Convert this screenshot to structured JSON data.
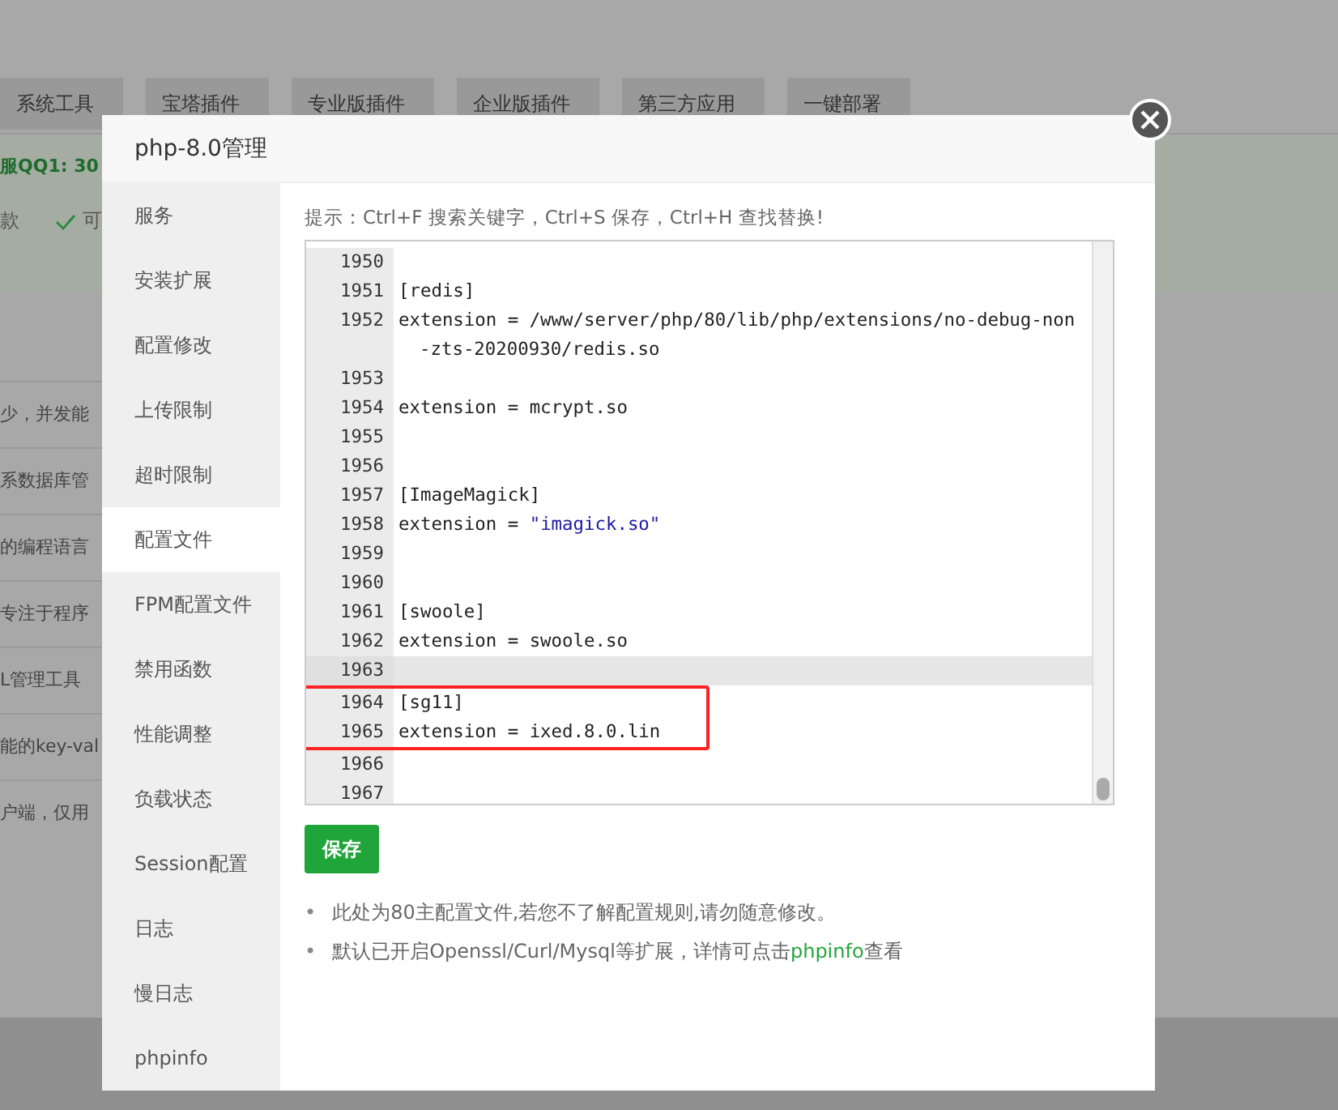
{
  "background": {
    "tabs": [
      {
        "label": "系统工具"
      },
      {
        "label": "宝塔插件"
      },
      {
        "label": "专业版插件"
      },
      {
        "label": "企业版插件"
      },
      {
        "label": "第三方应用"
      },
      {
        "label": "一键部署"
      }
    ],
    "banner": {
      "title": "服QQ1: 30",
      "items": [
        "款",
        "可"
      ]
    },
    "rows": [
      "少，并发能",
      "系数据库管",
      "的编程语言",
      "专注于程序",
      "L管理工具",
      "能的key-val",
      "户端，仅用"
    ]
  },
  "dialog": {
    "title": "php-8.0管理",
    "sidebar": [
      {
        "label": "服务",
        "selected": false
      },
      {
        "label": "安装扩展",
        "selected": false
      },
      {
        "label": "配置修改",
        "selected": false
      },
      {
        "label": "上传限制",
        "selected": false
      },
      {
        "label": "超时限制",
        "selected": false
      },
      {
        "label": "配置文件",
        "selected": true
      },
      {
        "label": "FPM配置文件",
        "selected": false
      },
      {
        "label": "禁用函数",
        "selected": false
      },
      {
        "label": "性能调整",
        "selected": false
      },
      {
        "label": "负载状态",
        "selected": false
      },
      {
        "label": "Session配置",
        "selected": false
      },
      {
        "label": "日志",
        "selected": false
      },
      {
        "label": "慢日志",
        "selected": false
      },
      {
        "label": "phpinfo",
        "selected": false
      }
    ],
    "hint": "提示：Ctrl+F 搜索关键字，Ctrl+S 保存，Ctrl+H 查找替换!",
    "editor": {
      "lines": [
        {
          "number": "1950",
          "current": false,
          "marked": false
        },
        {
          "number": "1951",
          "parts": [
            {
              "text": "[redis]",
              "kind": "plain"
            }
          ],
          "current": false,
          "marked": false
        },
        {
          "number": "1952",
          "parts": [
            {
              "text": "extension = /www/server/php/80/lib/php/extensions/no-debug-non",
              "kind": "plain"
            }
          ],
          "continuation": "-zts-20200930/redis.so",
          "current": false,
          "marked": false
        },
        {
          "number": "1953",
          "current": false,
          "marked": false
        },
        {
          "number": "1954",
          "parts": [
            {
              "text": "extension = mcrypt.so",
              "kind": "plain"
            }
          ],
          "current": false,
          "marked": false
        },
        {
          "number": "1955",
          "current": false,
          "marked": false
        },
        {
          "number": "1956",
          "current": false,
          "marked": false
        },
        {
          "number": "1957",
          "parts": [
            {
              "text": "[ImageMagick]",
              "kind": "plain"
            }
          ],
          "current": false,
          "marked": false
        },
        {
          "number": "1958",
          "parts": [
            {
              "text": "extension = ",
              "kind": "plain"
            },
            {
              "text": "\"imagick.so\"",
              "kind": "string"
            }
          ],
          "current": false,
          "marked": false
        },
        {
          "number": "1959",
          "current": false,
          "marked": false
        },
        {
          "number": "1960",
          "current": false,
          "marked": false
        },
        {
          "number": "1961",
          "parts": [
            {
              "text": "[swoole]",
              "kind": "plain"
            }
          ],
          "current": false,
          "marked": false
        },
        {
          "number": "1962",
          "parts": [
            {
              "text": "extension = swoole.so",
              "kind": "plain"
            }
          ],
          "current": false,
          "marked": false
        },
        {
          "number": "1963",
          "current": true,
          "marked": false
        },
        {
          "number": "1964",
          "parts": [
            {
              "text": "[sg11]",
              "kind": "plain"
            }
          ],
          "current": false,
          "marked": true
        },
        {
          "number": "1965",
          "parts": [
            {
              "text": "extension = ixed.8.0.lin",
              "kind": "plain"
            }
          ],
          "current": false,
          "marked": true
        },
        {
          "number": "1966",
          "current": false,
          "marked": false
        },
        {
          "number": "1967",
          "current": false,
          "marked": false
        }
      ]
    },
    "save_button": "保存",
    "notes": [
      {
        "marker": "•",
        "parts": [
          {
            "text": "此处为80主配置文件,若您不了解配置规则,请勿随意修改。",
            "kind": "plain"
          }
        ]
      },
      {
        "marker": "•",
        "parts": [
          {
            "text": "默认已开启Openssl/Curl/Mysql等扩展，详情可点击",
            "kind": "plain"
          },
          {
            "text": "phpinfo",
            "kind": "link"
          },
          {
            "text": "查看",
            "kind": "plain"
          }
        ]
      }
    ]
  }
}
